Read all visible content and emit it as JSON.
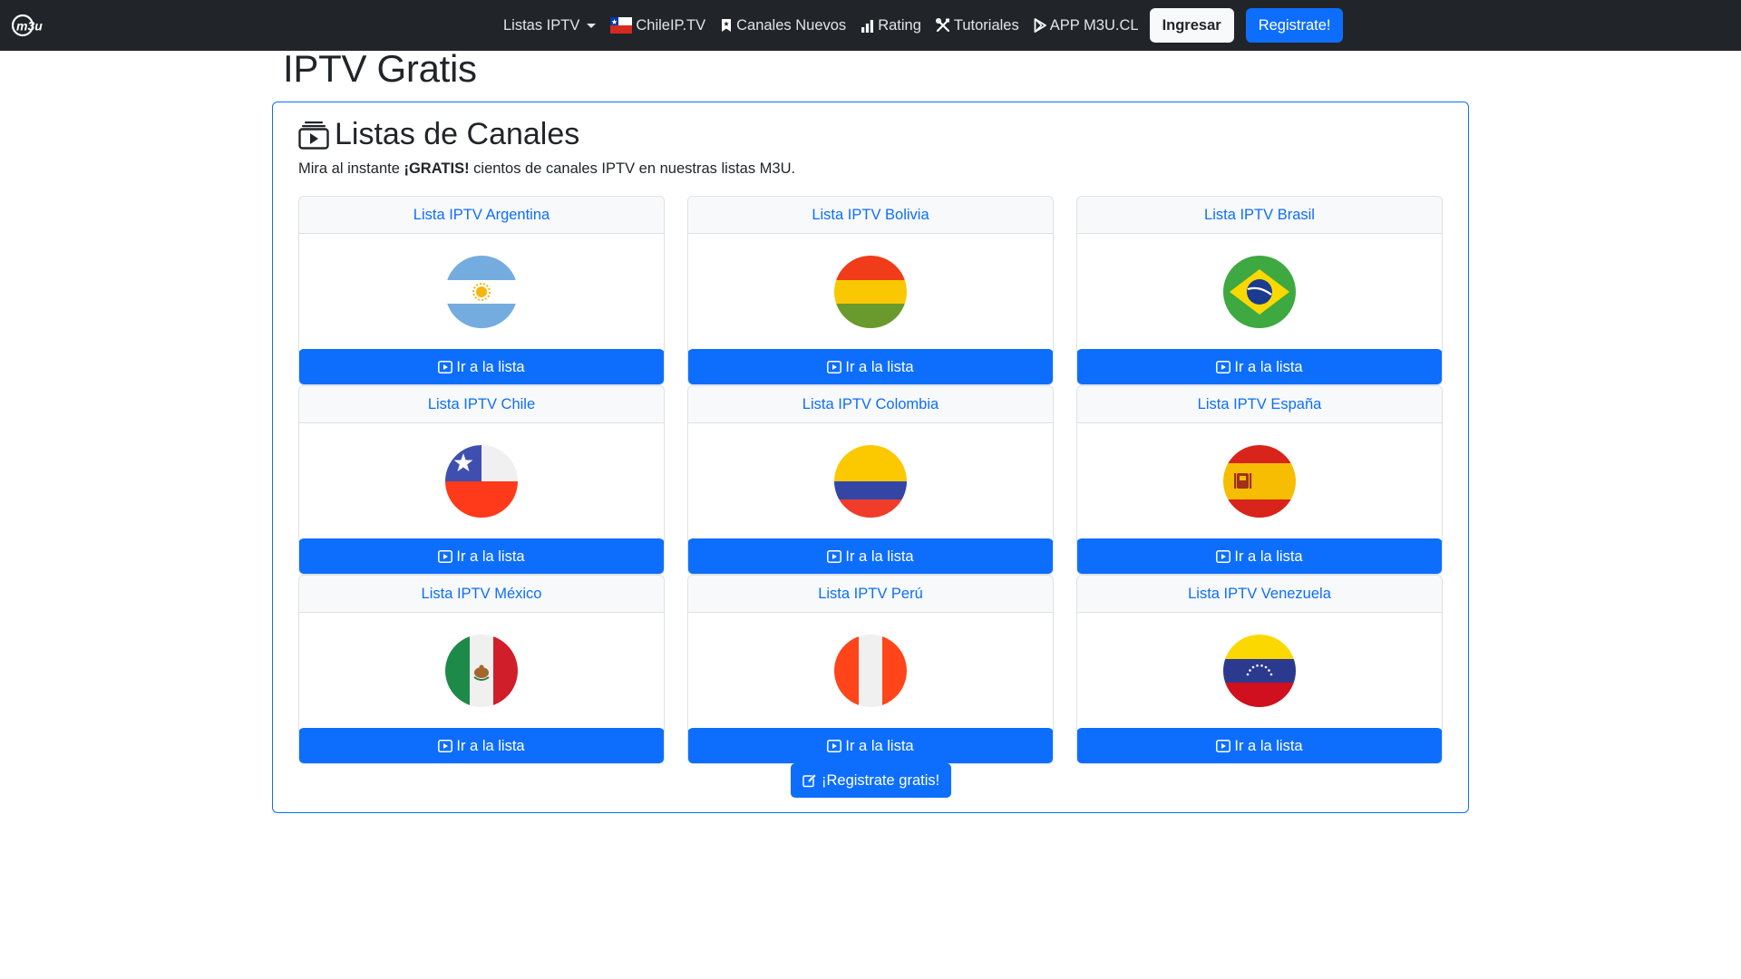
{
  "navbar": {
    "brand": "m3u.cl",
    "items": [
      {
        "label": "Listas IPTV",
        "icon": "none",
        "dropdown": true
      },
      {
        "label": "ChileIP.TV",
        "icon": "chile-flag-icon"
      },
      {
        "label": "Canales Nuevos",
        "icon": "bookmark-icon"
      },
      {
        "label": "Rating",
        "icon": "bar-chart-icon"
      },
      {
        "label": "Tutoriales",
        "icon": "tools-icon"
      },
      {
        "label": "APP M3U.CL",
        "icon": "play-store-icon"
      }
    ],
    "login_label": "Ingresar",
    "register_label": "Registrate!"
  },
  "page": {
    "title": "IPTV Gratis",
    "panel_title": "Listas de Canales",
    "lead_prefix": "Mira al instante ",
    "lead_bold": "¡GRATIS!",
    "lead_suffix": " cientos de canales IPTV en nuestras listas M3U."
  },
  "cards": [
    {
      "title": "Lista IPTV Argentina",
      "flag": "argentina",
      "button": "Ir a la lista"
    },
    {
      "title": "Lista IPTV Bolivia",
      "flag": "bolivia",
      "button": "Ir a la lista"
    },
    {
      "title": "Lista IPTV Brasil",
      "flag": "brasil",
      "button": "Ir a la lista"
    },
    {
      "title": "Lista IPTV Chile",
      "flag": "chile",
      "button": "Ir a la lista"
    },
    {
      "title": "Lista IPTV Colombia",
      "flag": "colombia",
      "button": "Ir a la lista"
    },
    {
      "title": "Lista IPTV España",
      "flag": "espana",
      "button": "Ir a la lista"
    },
    {
      "title": "Lista IPTV México",
      "flag": "mexico",
      "button": "Ir a la lista"
    },
    {
      "title": "Lista IPTV Perú",
      "flag": "peru",
      "button": "Ir a la lista"
    },
    {
      "title": "Lista IPTV Venezuela",
      "flag": "venezuela",
      "button": "Ir a la lista"
    }
  ],
  "cta_label": "¡Registrate gratis!",
  "colors": {
    "navbar_bg": "#212529",
    "primary": "#0d6efd",
    "card_header_bg": "#f8f9fa",
    "border": "#dee2e6"
  }
}
